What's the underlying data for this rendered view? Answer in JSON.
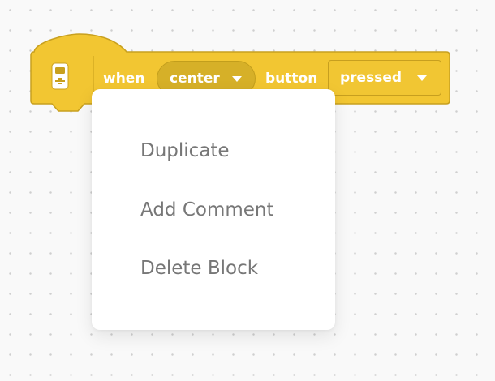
{
  "block": {
    "when_label": "when",
    "port_dropdown": {
      "value": "center",
      "icon": "caret-down-icon"
    },
    "button_label": "button",
    "state_dropdown": {
      "value": "pressed",
      "icon": "caret-down-icon"
    },
    "icon": "hub-icon",
    "colors": {
      "fill": "#f2c632",
      "border": "#c8a01f",
      "dropdown_fill": "#d6b028",
      "text": "#ffffff"
    }
  },
  "context_menu": {
    "items": [
      {
        "label": "Duplicate"
      },
      {
        "label": "Add Comment"
      },
      {
        "label": "Delete Block"
      }
    ],
    "colors": {
      "background": "#ffffff",
      "text": "#777777"
    }
  },
  "canvas": {
    "colors": {
      "background": "#f9f9f9",
      "dot": "#cfcfcf"
    }
  }
}
